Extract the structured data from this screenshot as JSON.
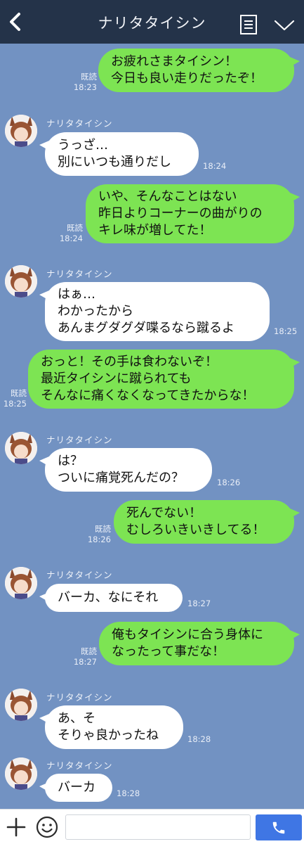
{
  "header": {
    "title": "ナリタタイシン",
    "back_icon": "chevron-left-icon",
    "note_icon": "notes-icon",
    "menu_icon": "chevron-down-icon",
    "background": "#243349"
  },
  "colors": {
    "chat_background": "#7292c2",
    "outgoing_bubble": "#7de453",
    "incoming_bubble": "#ffffff",
    "send_button": "#3f76e4"
  },
  "messages": [
    {
      "direction": "out",
      "lines": [
        "お疲れさまタイシン！",
        "今日も良い走りだったぞ！"
      ],
      "read": "既読",
      "time": "18:23"
    },
    {
      "direction": "in",
      "sender": "ナリタタイシン",
      "lines": [
        "うっざ…",
        "別にいつも通りだし"
      ],
      "time": "18:24"
    },
    {
      "direction": "out",
      "lines": [
        "いや、そんなことはない",
        "昨日よりコーナーの曲がりの",
        "キレ味が増してた！"
      ],
      "read": "既読",
      "time": "18:24"
    },
    {
      "direction": "in",
      "sender": "ナリタタイシン",
      "lines": [
        "はぁ…",
        "わかったから",
        "あんまグダグダ喋るなら蹴るよ"
      ],
      "time": "18:25"
    },
    {
      "direction": "out",
      "lines": [
        "おっと！その手は食わないぞ！",
        "最近タイシンに蹴られても",
        "そんなに痛くなくなってきたからな！"
      ],
      "read": "既読",
      "time": "18:25"
    },
    {
      "direction": "in",
      "sender": "ナリタタイシン",
      "lines": [
        "は？",
        "ついに痛覚死んだの？"
      ],
      "time": "18:26"
    },
    {
      "direction": "out",
      "lines": [
        "死んでない！",
        "むしろいきいきしてる！"
      ],
      "read": "既読",
      "time": "18:26"
    },
    {
      "direction": "in",
      "sender": "ナリタタイシン",
      "lines": [
        "バーカ、なにそれ"
      ],
      "time": "18:27"
    },
    {
      "direction": "out",
      "lines": [
        "俺もタイシンに合う身体に",
        "なったって事だな！"
      ],
      "read": "既読",
      "time": "18:27"
    },
    {
      "direction": "in",
      "sender": "ナリタタイシン",
      "lines": [
        "あ、そ",
        "そりゃ良かったね"
      ],
      "time": "18:28"
    },
    {
      "direction": "in",
      "sender": "ナリタタイシン",
      "lines": [
        "バーカ"
      ],
      "time": "18:28"
    }
  ],
  "footer": {
    "plus_icon": "plus-icon",
    "emoji_icon": "emoji-icon",
    "input_value": "",
    "input_placeholder": "",
    "call_icon": "phone-icon"
  }
}
